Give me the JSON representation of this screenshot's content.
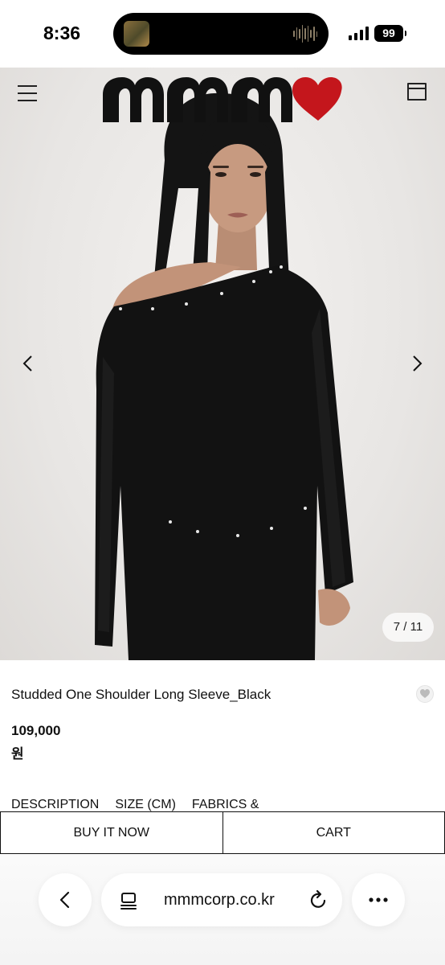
{
  "status_bar": {
    "time": "8:36",
    "battery": "99",
    "icons": [
      "signal-icon",
      "battery-icon",
      "now-playing-artwork",
      "audio-waveform-icon"
    ]
  },
  "header": {
    "brand": "mmm",
    "icons": [
      "menu-icon",
      "brand-logo",
      "heart-logo",
      "shopping-bag-icon"
    ],
    "colors": {
      "logo": "#111111",
      "heart": "#c4161c"
    }
  },
  "gallery": {
    "counter": "7 / 11",
    "icons": [
      "chevron-left-icon",
      "chevron-right-icon"
    ]
  },
  "product": {
    "title": "Studded One Shoulder Long Sleeve_Black",
    "price": "109,000",
    "currency": "원",
    "wishlist_icon": "heart-outline-icon"
  },
  "tabs": [
    {
      "label": "DESCRIPTION"
    },
    {
      "label": "SIZE (CM)"
    },
    {
      "label": "FABRICS &"
    }
  ],
  "actions": {
    "buy_now": "BUY IT NOW",
    "cart": "CART"
  },
  "browser": {
    "url": "mmmcorp.co.kr",
    "icons": [
      "back-arrow-icon",
      "tabs-overview-icon",
      "reload-icon",
      "more-options-icon"
    ]
  }
}
